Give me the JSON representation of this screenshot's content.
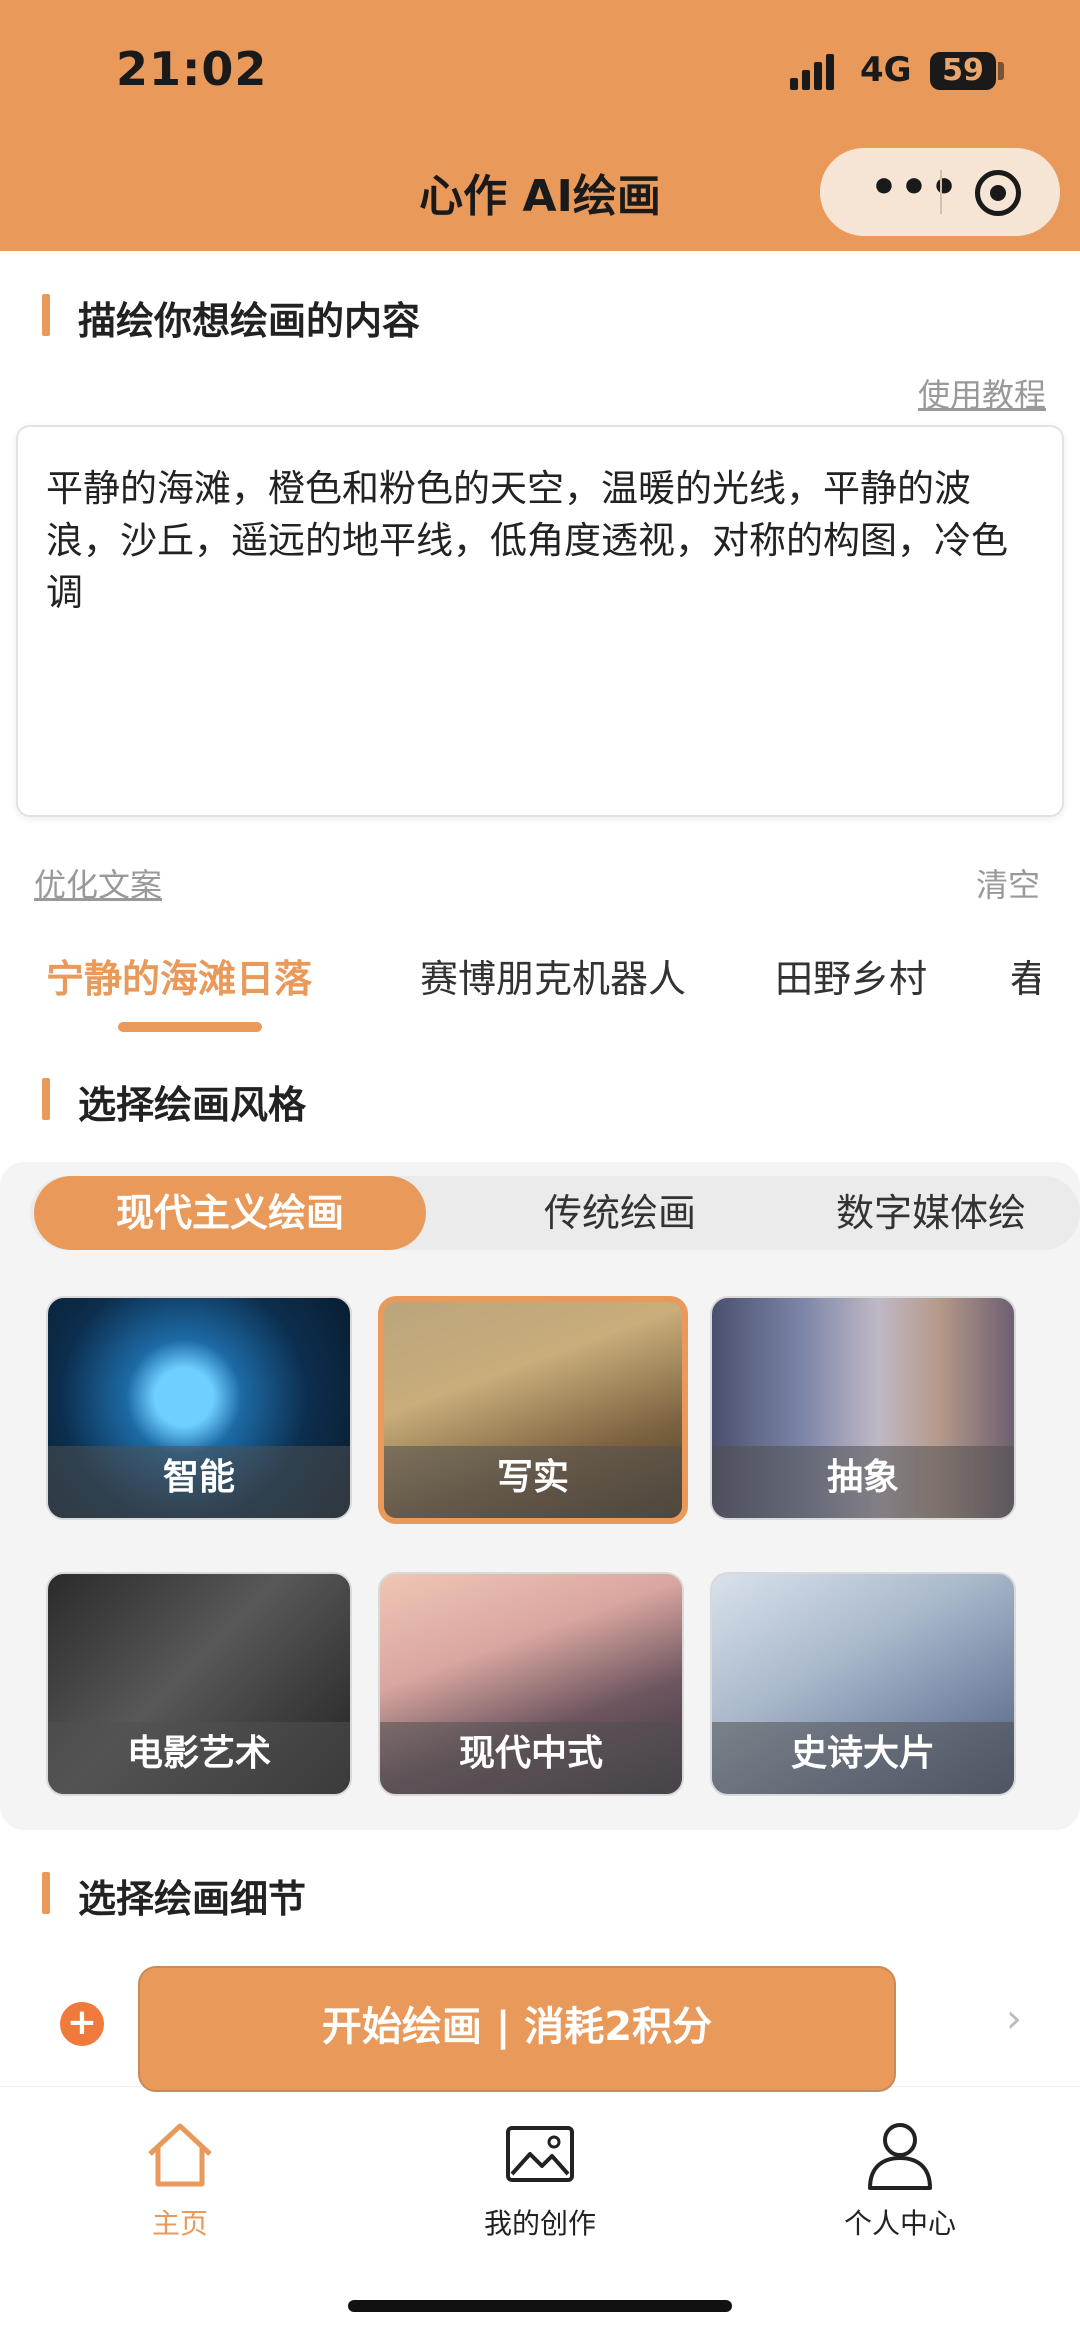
{
  "status_bar": {
    "time": "21:02",
    "network": "4G",
    "battery": "59"
  },
  "header": {
    "title": "心作 AI绘画",
    "more_glyph": "•••"
  },
  "describe": {
    "title": "描绘你想绘画的内容",
    "tutorial_link": "使用教程",
    "prompt": "平静的海滩，橙色和粉色的天空，温暖的光线，平静的波浪，沙丘，遥远的地平线，低角度透视，对称的构图，冷色调",
    "optimize_link": "优化文案",
    "clear_label": "清空"
  },
  "presets": [
    "宁静的海滩日落",
    "赛博朋克机器人",
    "田野乡村",
    "春"
  ],
  "style_section": {
    "title": "选择绘画风格",
    "tabs": [
      "现代主义绘画",
      "传统绘画",
      "数字媒体绘"
    ],
    "styles": [
      "智能",
      "写实",
      "抽象",
      "电影艺术",
      "现代中式",
      "史诗大片"
    ]
  },
  "details_section": {
    "title": "选择绘画细节"
  },
  "start": {
    "plus": "+",
    "label": "开始绘画 | 消耗2积分",
    "chevron": "›"
  },
  "tabbar": {
    "items": [
      "主页",
      "我的创作",
      "个人中心"
    ]
  },
  "colors": {
    "accent": "#e99a5b",
    "header_bg": "#e99a5b"
  }
}
